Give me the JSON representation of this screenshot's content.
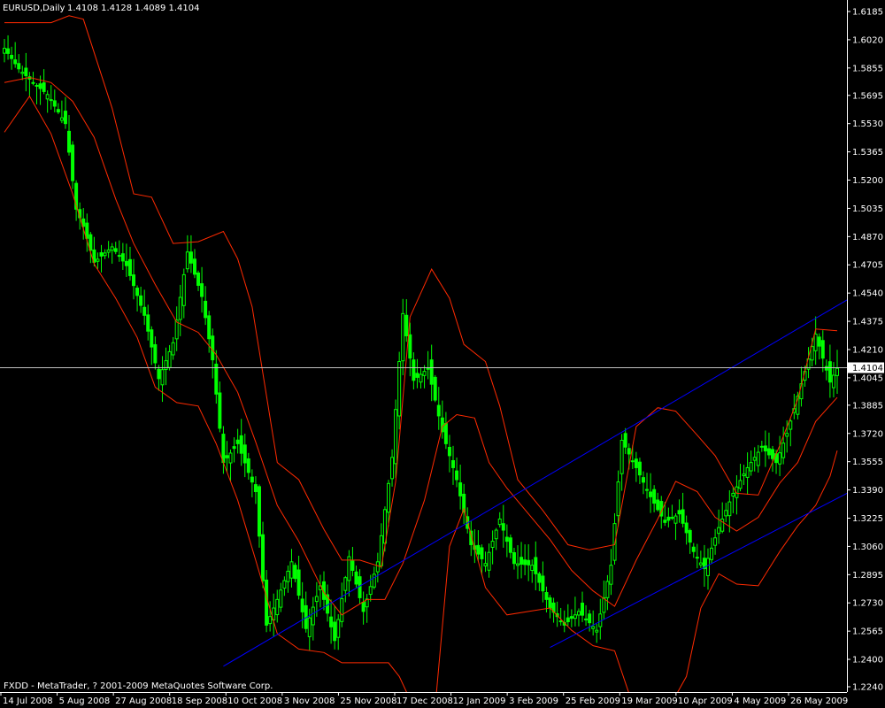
{
  "window_title": "EURUSD,Daily",
  "ohlc_header": "1.4108 1.4128 1.4089 1.4104",
  "footer": "FXDD - MetaTrader, ? 2001-2009 MetaQuotes Software Corp.",
  "current_price_label": "1.4104",
  "colors": {
    "background": "#000000",
    "candle": "#00ff00",
    "bands": "#ff2a00",
    "channel": "#0000ff",
    "price_line": "#c0c0c0",
    "axis": "#ffffff"
  },
  "chart_data": {
    "type": "candlestick",
    "symbol": "EURUSD",
    "timeframe": "Daily",
    "last_ohlc": {
      "open": 1.4108,
      "high": 1.4128,
      "low": 1.4089,
      "close": 1.4104
    },
    "ylim": [
      1.224,
      1.6185
    ],
    "y_ticks": [
      1.6185,
      1.602,
      1.5855,
      1.5695,
      1.553,
      1.5365,
      1.52,
      1.5035,
      1.487,
      1.4705,
      1.454,
      1.4375,
      1.421,
      1.4045,
      1.3885,
      1.372,
      1.3555,
      1.339,
      1.3225,
      1.306,
      1.2895,
      1.273,
      1.2565,
      1.24,
      1.224
    ],
    "x_tick_labels": [
      "14 Jul 2008",
      "5 Aug 2008",
      "27 Aug 2008",
      "18 Sep 2008",
      "10 Oct 2008",
      "3 Nov 2008",
      "25 Nov 2008",
      "17 Dec 2008",
      "12 Jan 2009",
      "3 Feb 2009",
      "25 Feb 2009",
      "19 Mar 2009",
      "10 Apr 2009",
      "4 May 2009",
      "26 May 2009"
    ],
    "bar_count": 233,
    "close_anchors": [
      {
        "bar": 0,
        "close": 1.597
      },
      {
        "bar": 4,
        "close": 1.585
      },
      {
        "bar": 8,
        "close": 1.577
      },
      {
        "bar": 12,
        "close": 1.57
      },
      {
        "bar": 17,
        "close": 1.553
      },
      {
        "bar": 20,
        "close": 1.503
      },
      {
        "bar": 22,
        "close": 1.493
      },
      {
        "bar": 25,
        "close": 1.472
      },
      {
        "bar": 30,
        "close": 1.481
      },
      {
        "bar": 34,
        "close": 1.47
      },
      {
        "bar": 39,
        "close": 1.441
      },
      {
        "bar": 43,
        "close": 1.404
      },
      {
        "bar": 47,
        "close": 1.425
      },
      {
        "bar": 51,
        "close": 1.478
      },
      {
        "bar": 55,
        "close": 1.452
      },
      {
        "bar": 58,
        "close": 1.415
      },
      {
        "bar": 61,
        "close": 1.355
      },
      {
        "bar": 65,
        "close": 1.366
      },
      {
        "bar": 70,
        "close": 1.338
      },
      {
        "bar": 73,
        "close": 1.26
      },
      {
        "bar": 76,
        "close": 1.275
      },
      {
        "bar": 80,
        "close": 1.297
      },
      {
        "bar": 84,
        "close": 1.258
      },
      {
        "bar": 88,
        "close": 1.283
      },
      {
        "bar": 92,
        "close": 1.251
      },
      {
        "bar": 96,
        "close": 1.3
      },
      {
        "bar": 100,
        "close": 1.268
      },
      {
        "bar": 104,
        "close": 1.297
      },
      {
        "bar": 108,
        "close": 1.358
      },
      {
        "bar": 111,
        "close": 1.442
      },
      {
        "bar": 114,
        "close": 1.403
      },
      {
        "bar": 118,
        "close": 1.41
      },
      {
        "bar": 122,
        "close": 1.373
      },
      {
        "bar": 126,
        "close": 1.345
      },
      {
        "bar": 130,
        "close": 1.307
      },
      {
        "bar": 134,
        "close": 1.296
      },
      {
        "bar": 138,
        "close": 1.322
      },
      {
        "bar": 142,
        "close": 1.296
      },
      {
        "bar": 147,
        "close": 1.295
      },
      {
        "bar": 152,
        "close": 1.27
      },
      {
        "bar": 156,
        "close": 1.26
      },
      {
        "bar": 160,
        "close": 1.268
      },
      {
        "bar": 165,
        "close": 1.257
      },
      {
        "bar": 169,
        "close": 1.295
      },
      {
        "bar": 172,
        "close": 1.368
      },
      {
        "bar": 176,
        "close": 1.352
      },
      {
        "bar": 180,
        "close": 1.335
      },
      {
        "bar": 184,
        "close": 1.32
      },
      {
        "bar": 188,
        "close": 1.325
      },
      {
        "bar": 192,
        "close": 1.303
      },
      {
        "bar": 195,
        "close": 1.293
      },
      {
        "bar": 199,
        "close": 1.317
      },
      {
        "bar": 203,
        "close": 1.337
      },
      {
        "bar": 207,
        "close": 1.352
      },
      {
        "bar": 211,
        "close": 1.364
      },
      {
        "bar": 215,
        "close": 1.355
      },
      {
        "bar": 218,
        "close": 1.372
      },
      {
        "bar": 222,
        "close": 1.401
      },
      {
        "bar": 226,
        "close": 1.43
      },
      {
        "bar": 230,
        "close": 1.402
      },
      {
        "bar": 232,
        "close": 1.41
      }
    ],
    "upper_band": [
      {
        "bar": 0,
        "value": 1.612
      },
      {
        "bar": 6,
        "value": 1.612
      },
      {
        "bar": 13,
        "value": 1.612
      },
      {
        "bar": 18,
        "value": 1.616
      },
      {
        "bar": 22,
        "value": 1.614
      },
      {
        "bar": 30,
        "value": 1.562
      },
      {
        "bar": 36,
        "value": 1.512
      },
      {
        "bar": 41,
        "value": 1.51
      },
      {
        "bar": 47,
        "value": 1.483
      },
      {
        "bar": 54,
        "value": 1.484
      },
      {
        "bar": 61,
        "value": 1.49
      },
      {
        "bar": 65,
        "value": 1.474
      },
      {
        "bar": 69,
        "value": 1.446
      },
      {
        "bar": 76,
        "value": 1.355
      },
      {
        "bar": 82,
        "value": 1.345
      },
      {
        "bar": 89,
        "value": 1.316
      },
      {
        "bar": 94,
        "value": 1.298
      },
      {
        "bar": 99,
        "value": 1.298
      },
      {
        "bar": 105,
        "value": 1.294
      },
      {
        "bar": 109,
        "value": 1.344
      },
      {
        "bar": 113,
        "value": 1.44
      },
      {
        "bar": 119,
        "value": 1.468
      },
      {
        "bar": 124,
        "value": 1.451
      },
      {
        "bar": 128,
        "value": 1.424
      },
      {
        "bar": 134,
        "value": 1.414
      },
      {
        "bar": 138,
        "value": 1.388
      },
      {
        "bar": 143,
        "value": 1.345
      },
      {
        "bar": 150,
        "value": 1.327
      },
      {
        "bar": 157,
        "value": 1.307
      },
      {
        "bar": 163,
        "value": 1.304
      },
      {
        "bar": 170,
        "value": 1.307
      },
      {
        "bar": 176,
        "value": 1.376
      },
      {
        "bar": 182,
        "value": 1.387
      },
      {
        "bar": 187,
        "value": 1.385
      },
      {
        "bar": 193,
        "value": 1.371
      },
      {
        "bar": 198,
        "value": 1.359
      },
      {
        "bar": 204,
        "value": 1.337
      },
      {
        "bar": 210,
        "value": 1.336
      },
      {
        "bar": 216,
        "value": 1.365
      },
      {
        "bar": 221,
        "value": 1.392
      },
      {
        "bar": 226,
        "value": 1.433
      },
      {
        "bar": 232,
        "value": 1.432
      }
    ],
    "middle_band": [
      {
        "bar": 0,
        "value": 1.577
      },
      {
        "bar": 7,
        "value": 1.58
      },
      {
        "bar": 13,
        "value": 1.577
      },
      {
        "bar": 19,
        "value": 1.566
      },
      {
        "bar": 25,
        "value": 1.545
      },
      {
        "bar": 31,
        "value": 1.509
      },
      {
        "bar": 36,
        "value": 1.483
      },
      {
        "bar": 42,
        "value": 1.459
      },
      {
        "bar": 48,
        "value": 1.437
      },
      {
        "bar": 54,
        "value": 1.431
      },
      {
        "bar": 59,
        "value": 1.418
      },
      {
        "bar": 65,
        "value": 1.396
      },
      {
        "bar": 70,
        "value": 1.367
      },
      {
        "bar": 76,
        "value": 1.33
      },
      {
        "bar": 82,
        "value": 1.309
      },
      {
        "bar": 89,
        "value": 1.279
      },
      {
        "bar": 94,
        "value": 1.266
      },
      {
        "bar": 101,
        "value": 1.275
      },
      {
        "bar": 106,
        "value": 1.275
      },
      {
        "bar": 111,
        "value": 1.296
      },
      {
        "bar": 117,
        "value": 1.333
      },
      {
        "bar": 122,
        "value": 1.376
      },
      {
        "bar": 126,
        "value": 1.383
      },
      {
        "bar": 131,
        "value": 1.381
      },
      {
        "bar": 135,
        "value": 1.355
      },
      {
        "bar": 140,
        "value": 1.34
      },
      {
        "bar": 146,
        "value": 1.325
      },
      {
        "bar": 152,
        "value": 1.31
      },
      {
        "bar": 158,
        "value": 1.292
      },
      {
        "bar": 164,
        "value": 1.28
      },
      {
        "bar": 170,
        "value": 1.271
      },
      {
        "bar": 176,
        "value": 1.298
      },
      {
        "bar": 182,
        "value": 1.322
      },
      {
        "bar": 187,
        "value": 1.344
      },
      {
        "bar": 193,
        "value": 1.338
      },
      {
        "bar": 198,
        "value": 1.323
      },
      {
        "bar": 204,
        "value": 1.315
      },
      {
        "bar": 210,
        "value": 1.323
      },
      {
        "bar": 216,
        "value": 1.343
      },
      {
        "bar": 221,
        "value": 1.355
      },
      {
        "bar": 226,
        "value": 1.379
      },
      {
        "bar": 232,
        "value": 1.393
      }
    ],
    "lower_band": [
      {
        "bar": 0,
        "value": 1.548
      },
      {
        "bar": 7,
        "value": 1.569
      },
      {
        "bar": 13,
        "value": 1.547
      },
      {
        "bar": 19,
        "value": 1.512
      },
      {
        "bar": 25,
        "value": 1.471
      },
      {
        "bar": 31,
        "value": 1.451
      },
      {
        "bar": 37,
        "value": 1.428
      },
      {
        "bar": 42,
        "value": 1.399
      },
      {
        "bar": 48,
        "value": 1.39
      },
      {
        "bar": 54,
        "value": 1.388
      },
      {
        "bar": 59,
        "value": 1.366
      },
      {
        "bar": 65,
        "value": 1.333
      },
      {
        "bar": 70,
        "value": 1.298
      },
      {
        "bar": 76,
        "value": 1.255
      },
      {
        "bar": 82,
        "value": 1.246
      },
      {
        "bar": 89,
        "value": 1.244
      },
      {
        "bar": 94,
        "value": 1.238
      },
      {
        "bar": 101,
        "value": 1.238
      },
      {
        "bar": 107,
        "value": 1.238
      },
      {
        "bar": 110,
        "value": 1.23
      },
      {
        "bar": 114,
        "value": 1.212
      },
      {
        "bar": 120,
        "value": 1.212
      },
      {
        "bar": 124,
        "value": 1.306
      },
      {
        "bar": 128,
        "value": 1.328
      },
      {
        "bar": 134,
        "value": 1.282
      },
      {
        "bar": 140,
        "value": 1.266
      },
      {
        "bar": 146,
        "value": 1.268
      },
      {
        "bar": 152,
        "value": 1.27
      },
      {
        "bar": 158,
        "value": 1.257
      },
      {
        "bar": 164,
        "value": 1.248
      },
      {
        "bar": 170,
        "value": 1.245
      },
      {
        "bar": 174,
        "value": 1.22
      },
      {
        "bar": 180,
        "value": 1.212
      },
      {
        "bar": 186,
        "value": 1.215
      },
      {
        "bar": 190,
        "value": 1.23
      },
      {
        "bar": 194,
        "value": 1.27
      },
      {
        "bar": 199,
        "value": 1.29
      },
      {
        "bar": 204,
        "value": 1.284
      },
      {
        "bar": 210,
        "value": 1.283
      },
      {
        "bar": 216,
        "value": 1.303
      },
      {
        "bar": 221,
        "value": 1.318
      },
      {
        "bar": 226,
        "value": 1.33
      },
      {
        "bar": 230,
        "value": 1.347
      },
      {
        "bar": 232,
        "value": 1.362
      }
    ],
    "channel_upper": {
      "start": {
        "bar": 61,
        "price": 1.236
      },
      "end": {
        "bar": 232,
        "price": 1.45
      }
    },
    "channel_lower": {
      "start": {
        "bar": 152,
        "price": 1.247
      },
      "end": {
        "bar": 232,
        "price": 1.337
      }
    },
    "current_price": 1.4104
  }
}
